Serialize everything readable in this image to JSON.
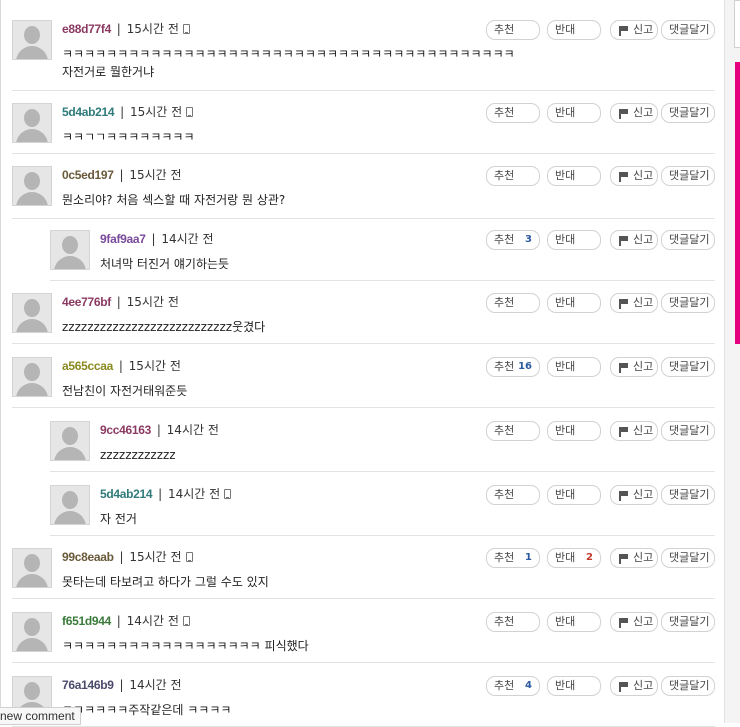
{
  "buttons": {
    "up_label": "추천",
    "down_label": "반대",
    "report_label": "신고",
    "reply_label": "댓글달기"
  },
  "new_comment_label": "new comment",
  "comments": [
    {
      "author": "e88d77f4",
      "author_color": "#8b3a62",
      "time": "15시간 전",
      "mobile": true,
      "lines": [
        "ㅋㅋㅋㅋㅋㅋㅋㅋㅋㅋㅋㅋㅋㅋㅋㅋㅋㅋㅋㅋㅋㅋㅋㅋㅋㅋㅋㅋㅋㅋㅋㅋㅋㅋㅋㅋㅋㅋㅋㅋㅋ",
        "자전거로 뭘한거냐"
      ],
      "up": "",
      "down": "",
      "reply": false
    },
    {
      "author": "5d4ab214",
      "author_color": "#2f7a7a",
      "time": "15시간 전",
      "mobile": true,
      "lines": [
        "ㅋㅋㄱㄱㅋㅋㅋㅋㅋㅋㅋㅋ"
      ],
      "up": "",
      "down": "",
      "reply": false
    },
    {
      "author": "0c5ed197",
      "author_color": "#6a5a3a",
      "time": "15시간 전",
      "mobile": false,
      "lines": [
        "뭔소리야? 처음 섹스할 때 자전거랑 뭔 상관?"
      ],
      "up": "",
      "down": "",
      "reply": false
    },
    {
      "author": "9faf9aa7",
      "author_color": "#7a4a9a",
      "time": "14시간 전",
      "mobile": false,
      "lines": [
        "처녀막 터진거 얘기하는듯"
      ],
      "up": "3",
      "down": "",
      "reply": true
    },
    {
      "author": "4ee776bf",
      "author_color": "#8b3a62",
      "time": "15시간 전",
      "mobile": false,
      "lines": [
        "zzzzzzzzzzzzzzzzzzzzzzzzzzz웃겼다"
      ],
      "up": "",
      "down": "",
      "reply": false
    },
    {
      "author": "a565ccaa",
      "author_color": "#8a8a20",
      "time": "15시간 전",
      "mobile": false,
      "lines": [
        "전남친이 자전거태워준듯"
      ],
      "up": "16",
      "down": "",
      "reply": false
    },
    {
      "author": "9cc46163",
      "author_color": "#8b3a62",
      "time": "14시간 전",
      "mobile": false,
      "lines": [
        "zzzzzzzzzzzz"
      ],
      "up": "",
      "down": "",
      "reply": true
    },
    {
      "author": "5d4ab214",
      "author_color": "#2f7a7a",
      "time": "14시간 전",
      "mobile": true,
      "lines": [
        "자 전거"
      ],
      "up": "",
      "down": "",
      "reply": true
    },
    {
      "author": "99c8eaab",
      "author_color": "#6a5a3a",
      "time": "15시간 전",
      "mobile": true,
      "lines": [
        "못타는데 타보려고 하다가 그럴 수도 있지"
      ],
      "up": "1",
      "down": "2",
      "reply": false
    },
    {
      "author": "f651d944",
      "author_color": "#3a7a3a",
      "time": "14시간 전",
      "mobile": true,
      "lines": [
        "ㅋㅋㅋㅋㅋㅋㅋㅋㅋㅋㅋㅋㅋㅋㅋㅋㅋㅋ 피식했다"
      ],
      "up": "",
      "down": "",
      "reply": false
    },
    {
      "author": "76a146b9",
      "author_color": "#4a4a6a",
      "time": "14시간 전",
      "mobile": false,
      "lines": [
        "ㅋㅋㅋㅋㅋㅋ주작같은데 ㅋㅋㅋㅋ"
      ],
      "up": "4",
      "down": "",
      "reply": false
    }
  ]
}
